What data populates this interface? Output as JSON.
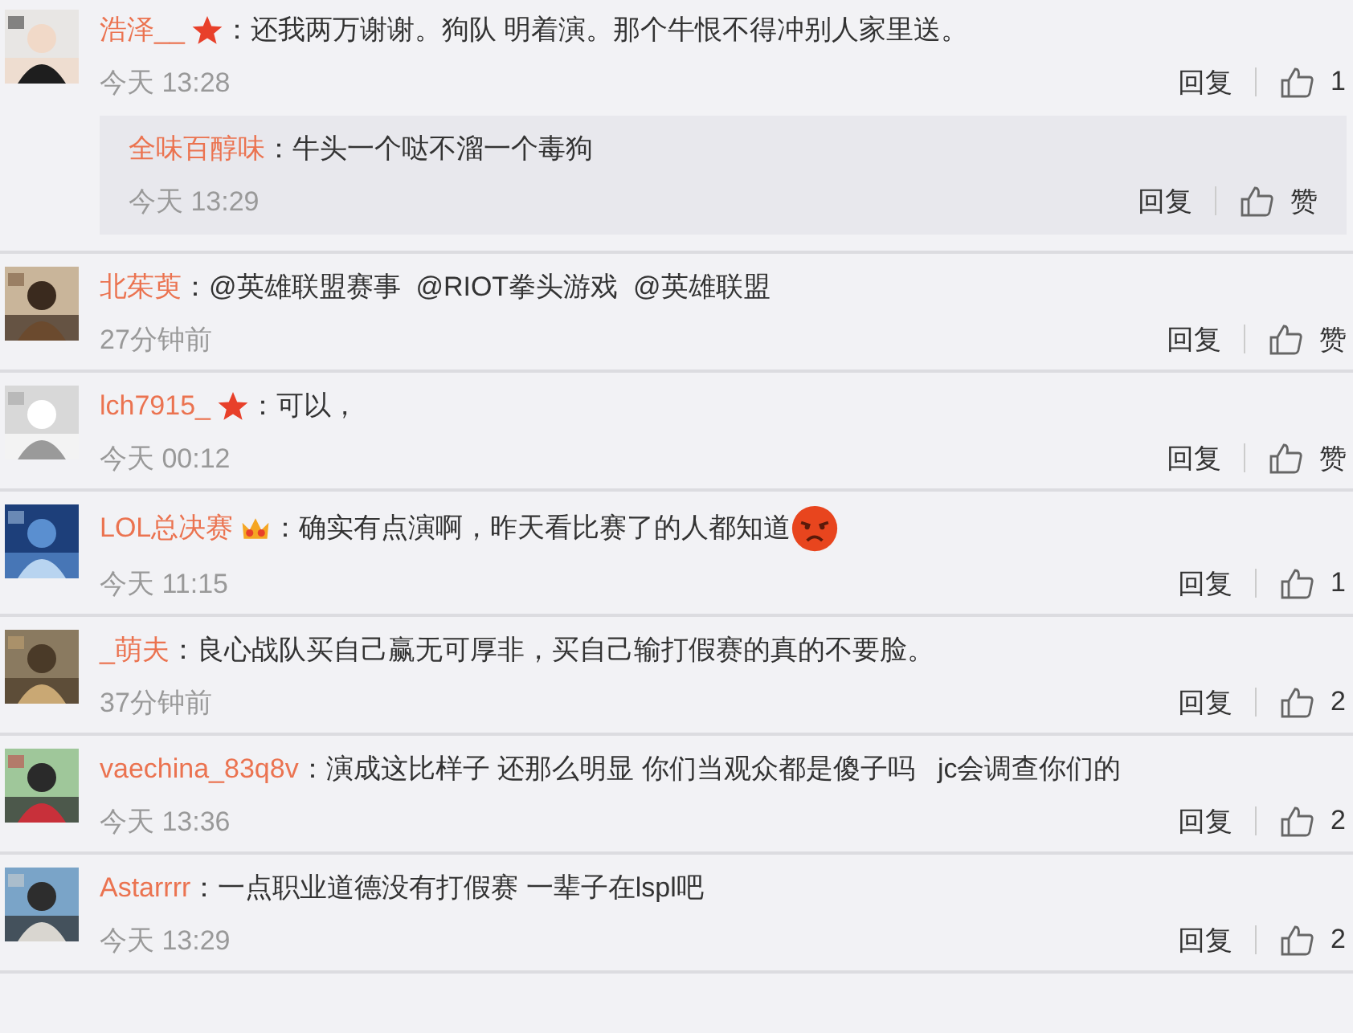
{
  "comments": [
    {
      "user": "浩泽__",
      "star_badge": true,
      "crown_badge": false,
      "angry_emoji": false,
      "text": "：还我两万谢谢。狗队 明着演。那个牛恨不得冲别人家里送。",
      "time": "今天 13:28",
      "reply_label": "回复",
      "likes": "1",
      "replies": [
        {
          "user": "全味百醇味",
          "text": "：牛头一个哒不溜一个毒狗",
          "time": "今天 13:29",
          "reply_label": "回复",
          "likes": "赞"
        }
      ]
    },
    {
      "user": "北茱萸",
      "star_badge": false,
      "crown_badge": false,
      "angry_emoji": false,
      "text": "：@英雄联盟赛事  @RIOT拳头游戏  @英雄联盟",
      "time": "27分钟前",
      "reply_label": "回复",
      "likes": "赞"
    },
    {
      "user": "lch7915_",
      "star_badge": true,
      "crown_badge": false,
      "angry_emoji": false,
      "text": "：可以，",
      "time": "今天 00:12",
      "reply_label": "回复",
      "likes": "赞"
    },
    {
      "user": "LOL总决赛",
      "star_badge": false,
      "crown_badge": true,
      "angry_emoji": true,
      "text": "：确实有点演啊，昨天看比赛了的人都知道",
      "time": "今天 11:15",
      "reply_label": "回复",
      "likes": "1"
    },
    {
      "user": "_萌夫",
      "star_badge": false,
      "crown_badge": false,
      "angry_emoji": false,
      "text": "：良心战队买自己赢无可厚非，买自己输打假赛的真的不要脸。",
      "time": "37分钟前",
      "reply_label": "回复",
      "likes": "2"
    },
    {
      "user": "vaechina_83q8v",
      "star_badge": false,
      "crown_badge": false,
      "angry_emoji": false,
      "text": "：演成这比样子 还那么明显 你们当观众都是傻子吗   jc会调查你们的",
      "time": "今天 13:36",
      "reply_label": "回复",
      "likes": "2"
    },
    {
      "user": "Astarrrr",
      "star_badge": false,
      "crown_badge": false,
      "angry_emoji": false,
      "text": "：一点职业道德没有打假赛 一辈子在lspl吧",
      "time": "今天 13:29",
      "reply_label": "回复",
      "likes": "2"
    }
  ]
}
